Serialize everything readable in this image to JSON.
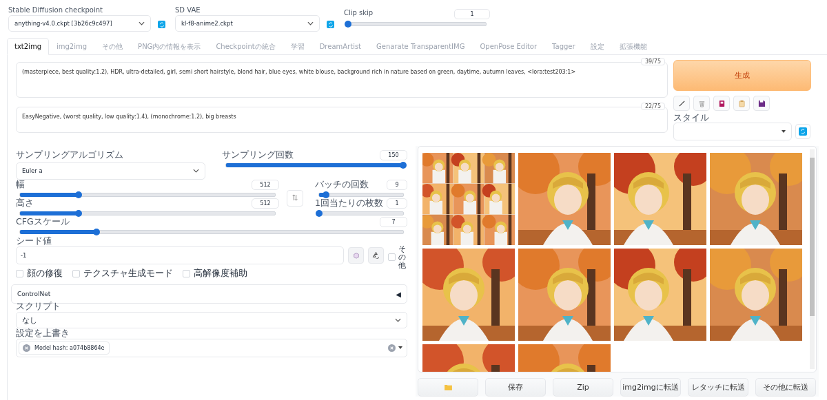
{
  "top": {
    "checkpoint": {
      "label": "Stable Diffusion checkpoint",
      "value": "anything-v4.0.ckpt [3b26c9c497]"
    },
    "vae": {
      "label": "SD VAE",
      "value": "kl-f8-anime2.ckpt"
    },
    "clip_skip": {
      "label": "Clip skip",
      "value": "1",
      "level": 0
    }
  },
  "tabs": [
    {
      "label": "txt2img",
      "selected": true
    },
    {
      "label": "img2img",
      "selected": false
    },
    {
      "label": "その他",
      "selected": false
    },
    {
      "label": "PNG内の情報を表示",
      "selected": false
    },
    {
      "label": "Checkpointの統合",
      "selected": false
    },
    {
      "label": "学習",
      "selected": false
    },
    {
      "label": "DreamArtist",
      "selected": false
    },
    {
      "label": "Genarate TransparentIMG",
      "selected": false
    },
    {
      "label": "OpenPose Editor",
      "selected": false
    },
    {
      "label": "Tagger",
      "selected": false
    },
    {
      "label": "設定",
      "selected": false
    },
    {
      "label": "拡張機能",
      "selected": false
    }
  ],
  "prompt": {
    "text": "(masterpiece, best quality:1.2), HDR, ultra-detailed, girl, semi short hairstyle, blond hair, blue eyes, white blouse, background rich in nature based on green, daytime, autumn leaves,  <lora:test203:1>",
    "count": "39/75"
  },
  "negative_prompt": {
    "text": "EasyNegative, (worst quality, low quality:1.4), (monochrome:1.2), big breasts",
    "count": "22/75"
  },
  "generate_button": "生成",
  "style": {
    "label": "スタイル"
  },
  "sampler": {
    "label": "サンプリングアルゴリズム",
    "value": "Euler a"
  },
  "sliders": [
    {
      "label": "サンプリング回数",
      "value": "150",
      "level": 1.0
    },
    {
      "label": "幅",
      "value": "512",
      "level": 0.23
    },
    {
      "label": "バッチの回数",
      "value": "9",
      "level": 0.08
    },
    {
      "label": "高さ",
      "value": "512",
      "level": 0.23
    },
    {
      "label": "1回当たりの枚数",
      "value": "1",
      "level": 0
    },
    {
      "label": "CFGスケール",
      "value": "7",
      "level": 0.2
    }
  ],
  "seed": {
    "label": "シード値",
    "value": "-1",
    "extra_label": "その他",
    "extra_checked": false
  },
  "options": [
    {
      "label": "顔の修復",
      "checked": false
    },
    {
      "label": "テクスチャ生成モード",
      "checked": false
    },
    {
      "label": "高解像度補助",
      "checked": false
    }
  ],
  "controlnet": {
    "title": "ControlNet",
    "toggle": "◀"
  },
  "script": {
    "label": "スクリプト",
    "value": "なし"
  },
  "override": {
    "label": "設定を上書き",
    "chip": "Model hash: a074b8864e"
  },
  "gallery": {
    "images": [
      {
        "kind": "grid"
      },
      {
        "kind": "picture"
      },
      {
        "kind": "picture"
      },
      {
        "kind": "picture"
      },
      {
        "kind": "picture"
      },
      {
        "kind": "picture"
      },
      {
        "kind": "picture"
      },
      {
        "kind": "picture"
      },
      {
        "kind": "picture"
      },
      {
        "kind": "picture"
      }
    ]
  },
  "actions": [
    {
      "kind": "folder"
    },
    {
      "kind": "text",
      "label": "保存"
    },
    {
      "kind": "text",
      "label": "Zip"
    },
    {
      "kind": "text",
      "label": "img2imgに転送"
    },
    {
      "kind": "text",
      "label": "レタッチに転送"
    },
    {
      "kind": "text",
      "label": "その他に転送"
    }
  ]
}
